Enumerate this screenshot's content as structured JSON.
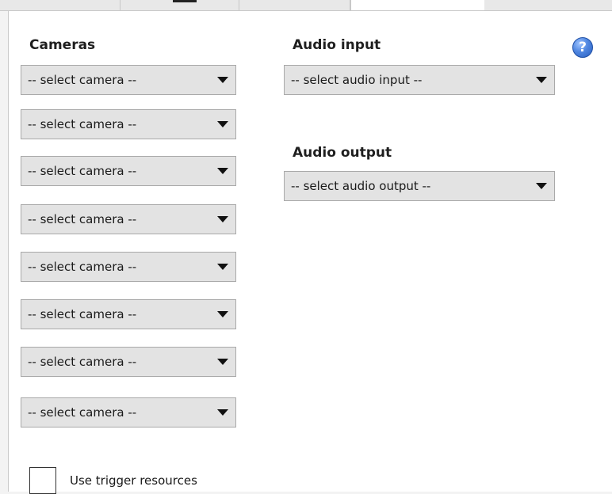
{
  "cameras": {
    "label": "Cameras",
    "selects": [
      {
        "value": "-- select camera --"
      },
      {
        "value": "-- select camera --"
      },
      {
        "value": "-- select camera --"
      },
      {
        "value": "-- select camera --"
      },
      {
        "value": "-- select camera --"
      },
      {
        "value": "-- select camera --"
      },
      {
        "value": "-- select camera --"
      },
      {
        "value": "-- select camera --"
      }
    ]
  },
  "audio_input": {
    "label": "Audio input",
    "value": "-- select audio input --"
  },
  "audio_output": {
    "label": "Audio output",
    "value": "-- select audio output --"
  },
  "help": {
    "icon": "help-icon",
    "glyph": "?"
  },
  "use_trigger": {
    "label": "Use trigger resources",
    "checked": false
  }
}
